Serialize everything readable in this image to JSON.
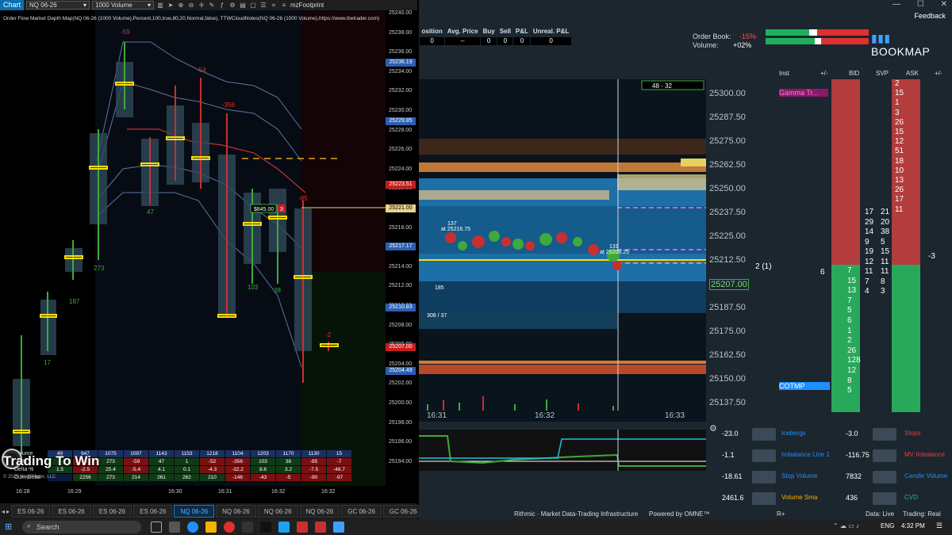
{
  "nt": {
    "window_title": "Chart",
    "instrument": "NQ 06-26",
    "interval": "1000 Volume",
    "indicator_name": "mzFootprint",
    "chart_label": "Order Flow Market Depth Map(NQ 06-26 (1000 Volume),Percent,100,true,80,20,Normal,false), TTWCloudNotes(NQ 06-26 (1000 Volume),https://www.ttwtrader.com)",
    "price_ticks": [
      "25240.00",
      "25238.00",
      "25236.00",
      "25234.00",
      "25232.00",
      "25230.00",
      "25228.00",
      "25226.00",
      "25224.00",
      "25222.00",
      "25220.00",
      "25218.00",
      "25216.00",
      "25214.00",
      "25212.00",
      "25210.00",
      "25208.00",
      "25206.00",
      "25204.00",
      "25202.00",
      "25200.00",
      "25198.00",
      "25196.00",
      "25194.00"
    ],
    "price_badges": [
      {
        "label": "25236.19",
        "color": "#2d5fb0"
      },
      {
        "label": "25229.85",
        "color": "#2d5fb0"
      },
      {
        "label": "25223.51",
        "color": "#c81d1d"
      },
      {
        "label": "25221.00",
        "color": "#e8d38a"
      },
      {
        "label": "25217.17",
        "color": "#2d5fb0"
      },
      {
        "label": "25210.83",
        "color": "#2d5fb0"
      },
      {
        "label": "25207.00",
        "color": "#c81d1d"
      },
      {
        "label": "25204.49",
        "color": "#2d5fb0"
      }
    ],
    "time_ticks": [
      "16:28",
      "16:29",
      "16:30",
      "16:31",
      "16:32",
      "16:32"
    ],
    "bar_labels_top": [
      "-59",
      "-54",
      "-356",
      "-85",
      "-2"
    ],
    "bar_labels_bottom": [
      "17",
      "187",
      "273",
      "47",
      "103",
      "38"
    ],
    "price_tag": "$845.00",
    "price_tag_qty": "3",
    "stats": {
      "row_names": [
        "Volume",
        "Delta",
        "Delta %",
        "Cum Delta"
      ],
      "volume": [
        "49",
        "647",
        "1075",
        "1097",
        "1143",
        "1153",
        "1218",
        "1104",
        "1203",
        "1170",
        "1130",
        "15"
      ],
      "delta": [
        "1",
        "-2",
        "273",
        "-59",
        "47",
        "1",
        "-52",
        "-356",
        "103",
        "38",
        "-85",
        "-7"
      ],
      "delta_pct": [
        "1.5",
        "-2.5",
        "25.4",
        "-5.4",
        "4.1",
        "0.1",
        "-4.3",
        "-32.2",
        "8.6",
        "3.2",
        "-7.5",
        "-46.7"
      ],
      "cum_delta": [
        "",
        "2256",
        "273",
        "214",
        "261",
        "262",
        "210",
        "-146",
        "-43",
        "-5",
        "-90",
        "-97"
      ]
    },
    "copyright": "© 2026 NinjaTrader, LLC",
    "watermark": "Trading To Win",
    "tabs": [
      "ES 06-26",
      "ES 06-26",
      "ES 06-26",
      "ES 06-26",
      "NQ 06-26",
      "NQ 06-26",
      "NQ 06-26",
      "NQ 06-26",
      "GC 06-26",
      "GC 06-26",
      "GC 06-26"
    ],
    "active_tab": 5
  },
  "bm": {
    "feedback": "Feedback",
    "pos_headers": [
      "osition",
      "Avg. Price",
      "Buy",
      "Sell",
      "P&L",
      "Unreal. P&L"
    ],
    "pos_values": [
      "0",
      "--",
      "0",
      "0",
      "0",
      "0"
    ],
    "orderbook_label": "Order Book:",
    "orderbook_value": "-15%",
    "volume_label": "Volume:",
    "volume_value": "+02%",
    "logo": "BOOKMAP",
    "range_label": "48 - 32",
    "dom_headers": [
      "Inst",
      "+/-",
      "BID",
      "SVP",
      "ASK",
      "+/-"
    ],
    "price_ladder": [
      "25300.00",
      "25287.50",
      "25275.00",
      "25262.50",
      "25250.00",
      "25237.50",
      "25225.00",
      "25212.50",
      "25207.00",
      "25187.50",
      "25175.00",
      "25162.50",
      "25150.00",
      "25137.50"
    ],
    "ask_sizes": [
      "2",
      "15",
      "1",
      "3",
      "26",
      "15",
      "12",
      "51",
      "18",
      "10",
      "13",
      "26",
      "17",
      "11"
    ],
    "bid_sizes": [
      "7",
      "15",
      "13",
      "7",
      "5",
      "6",
      "1",
      "2",
      "26",
      "128",
      "12",
      "8",
      "5"
    ],
    "svp_left": [
      "17",
      "29",
      "14",
      "9",
      "19",
      "12",
      "11",
      "7",
      "4"
    ],
    "svp_right": [
      "21",
      "20",
      "38",
      "5",
      "15",
      "11",
      "11",
      "8",
      "3"
    ],
    "ask_delta": "-3",
    "bid_delta": "6",
    "mid_marker": "2 (1)",
    "annot_top": "Gamma Tr...",
    "annot_bottom": "COTMP",
    "time_ticks": [
      "16:31",
      "16:32",
      "16:33"
    ],
    "heat_labels": [
      "137",
      "at 25216.75",
      "131",
      "at 25208.25",
      "185",
      "308 / 37"
    ],
    "indicators": [
      {
        "value": "-23.0",
        "name": "Icebergs",
        "name_color": "#1e90ff",
        "value2": "-3.0",
        "name2": "Stops",
        "name2_color": "#e04040"
      },
      {
        "value": "-1.1",
        "name": "Imbalance Line 1",
        "name_color": "#1e90ff",
        "value2": "-116.75",
        "name2": "MV Imbalance",
        "name2_color": "#e04040"
      },
      {
        "value": "-18.61",
        "name": "Stop Volume",
        "name_color": "#1e90ff",
        "value2": "7832",
        "name2": "Candle Volume",
        "name2_color": "#1e90ff"
      },
      {
        "value": "2461.6",
        "name": "Volume Sma",
        "name_color": "#ffb000",
        "value2": "436",
        "name2": "CVD",
        "name2_color": "#3cb371"
      }
    ],
    "rithmic": "Rithmic · Market Data-Trading Infrastructure",
    "omne": "Powered by OMNE™",
    "r_plus": "R+",
    "data_status": "Data: Live",
    "trading_status": "Trading: Real"
  },
  "taskbar": {
    "search_placeholder": "Search",
    "lang": "ENG",
    "time": "4:32 PM"
  }
}
